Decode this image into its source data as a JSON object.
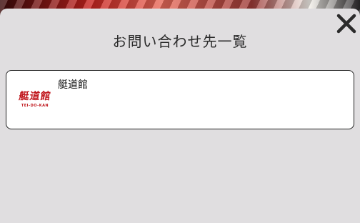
{
  "modal": {
    "title": "お問い合わせ先一覧",
    "close_icon": "close-icon"
  },
  "contacts": [
    {
      "name": "艇道館",
      "logo_text": "艇道館",
      "logo_subtext": "TEI-DO-KAN",
      "logo_color": "#c0151b"
    }
  ]
}
